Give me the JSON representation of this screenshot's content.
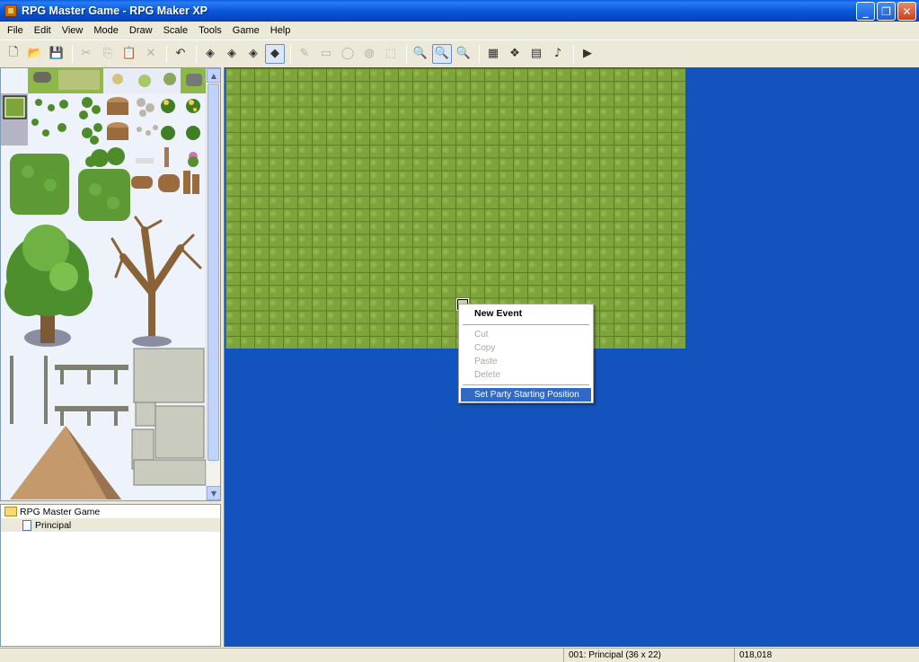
{
  "window": {
    "title": "RPG Master Game - RPG Maker XP",
    "buttons": {
      "minimize": "_",
      "restore": "❐",
      "close": "✕"
    }
  },
  "menu": [
    "File",
    "Edit",
    "View",
    "Mode",
    "Draw",
    "Scale",
    "Tools",
    "Game",
    "Help"
  ],
  "toolbar": {
    "groups": [
      [
        {
          "icon": "new-file-icon",
          "glyph": "🗋"
        },
        {
          "icon": "open-folder-icon",
          "glyph": "📂"
        },
        {
          "icon": "save-icon",
          "glyph": "💾"
        }
      ],
      [
        {
          "icon": "cut-icon",
          "glyph": "✂",
          "disabled": true
        },
        {
          "icon": "copy-icon",
          "glyph": "⎘",
          "disabled": true
        },
        {
          "icon": "paste-icon",
          "glyph": "📋",
          "disabled": true
        },
        {
          "icon": "delete-icon",
          "glyph": "✕",
          "disabled": true
        }
      ],
      [
        {
          "icon": "undo-icon",
          "glyph": "↶"
        }
      ],
      [
        {
          "icon": "layer-1-icon",
          "glyph": "◈"
        },
        {
          "icon": "layer-2-icon",
          "glyph": "◈"
        },
        {
          "icon": "layer-3-icon",
          "glyph": "◈"
        },
        {
          "icon": "event-layer-icon",
          "glyph": "◆",
          "pressed": true
        }
      ],
      [
        {
          "icon": "pencil-icon",
          "glyph": "✎",
          "disabled": true
        },
        {
          "icon": "rectangle-icon",
          "glyph": "▭",
          "disabled": true
        },
        {
          "icon": "ellipse-icon",
          "glyph": "◯",
          "disabled": true
        },
        {
          "icon": "fill-icon",
          "glyph": "◍",
          "disabled": true
        },
        {
          "icon": "select-icon",
          "glyph": "⬚",
          "disabled": true
        }
      ],
      [
        {
          "icon": "zoom-1-icon",
          "glyph": "🔍"
        },
        {
          "icon": "zoom-2-icon",
          "glyph": "🔍",
          "pressed": true
        },
        {
          "icon": "zoom-4-icon",
          "glyph": "🔍"
        }
      ],
      [
        {
          "icon": "database-icon",
          "glyph": "▦"
        },
        {
          "icon": "materialbase-icon",
          "glyph": "❖"
        },
        {
          "icon": "script-editor-icon",
          "glyph": "▤"
        },
        {
          "icon": "sound-test-icon",
          "glyph": "♪"
        }
      ],
      [
        {
          "icon": "playtest-icon",
          "glyph": "▶"
        }
      ]
    ]
  },
  "tree": {
    "project": "RPG Master Game",
    "maps": [
      "Principal"
    ]
  },
  "context_menu": {
    "items": [
      {
        "label": "New Event",
        "bold": true
      },
      {
        "separator": true
      },
      {
        "label": "Cut",
        "disabled": true
      },
      {
        "label": "Copy",
        "disabled": true
      },
      {
        "label": "Paste",
        "disabled": true
      },
      {
        "label": "Delete",
        "disabled": true
      },
      {
        "separator": true
      },
      {
        "label": "Set Party Starting Position",
        "highlighted": true
      }
    ]
  },
  "status": {
    "map_info": "001: Principal (36 x 22)",
    "coords": "018,018"
  },
  "colors": {
    "map_background": "#1353bd",
    "grass": "#7fa43e",
    "highlight": "#316ac5"
  }
}
